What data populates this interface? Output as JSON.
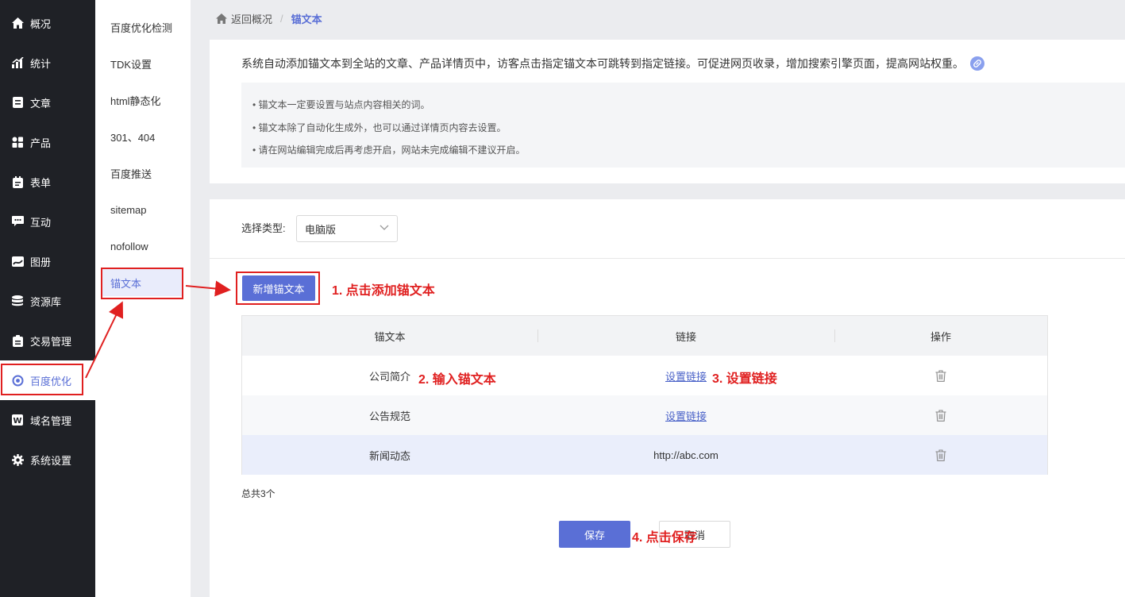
{
  "sidebar": {
    "items": [
      {
        "label": "概况",
        "icon": "home-icon"
      },
      {
        "label": "统计",
        "icon": "stats-icon"
      },
      {
        "label": "文章",
        "icon": "article-icon"
      },
      {
        "label": "产品",
        "icon": "product-icon"
      },
      {
        "label": "表单",
        "icon": "form-icon"
      },
      {
        "label": "互动",
        "icon": "chat-icon"
      },
      {
        "label": "图册",
        "icon": "album-icon"
      },
      {
        "label": "资源库",
        "icon": "database-icon"
      },
      {
        "label": "交易管理",
        "icon": "trade-icon"
      },
      {
        "label": "百度优化",
        "icon": "seo-icon"
      },
      {
        "label": "域名管理",
        "icon": "domain-icon"
      },
      {
        "label": "系统设置",
        "icon": "gear-icon"
      }
    ],
    "active": "百度优化"
  },
  "subnav": {
    "items": [
      "百度优化检测",
      "TDK设置",
      "html静态化",
      "301、404",
      "百度推送",
      "sitemap",
      "nofollow",
      "锚文本"
    ],
    "active": "锚文本"
  },
  "breadcrumb": {
    "back": "返回概况",
    "sep": "/",
    "current": "锚文本"
  },
  "info": {
    "description": "系统自动添加锚文本到全站的文章、产品详情页中，访客点击指定锚文本可跳转到指定链接。可促进网页收录，增加搜索引擎页面，提高网站权重。",
    "tips": [
      "• 锚文本一定要设置与站点内容相关的词。",
      "• 锚文本除了自动化生成外，也可以通过详情页内容去设置。",
      "• 请在网站编辑完成后再考虑开启，网站未完成编辑不建议开启。"
    ]
  },
  "filter": {
    "label": "选择类型:",
    "value": "电脑版"
  },
  "add_button": "新增锚文本",
  "table": {
    "headers": [
      "锚文本",
      "链接",
      "操作"
    ],
    "rows": [
      {
        "anchor": "公司简介",
        "link": "设置链接",
        "link_is_action": true
      },
      {
        "anchor": "公告规范",
        "link": "设置链接",
        "link_is_action": true
      },
      {
        "anchor": "新闻动态",
        "link": "http://abc.com",
        "link_is_action": false
      }
    ]
  },
  "total": "总共3个",
  "save_button": "保存",
  "cancel_button": "取消",
  "annotations": {
    "step1": "1. 点击添加锚文本",
    "step2": "2. 输入锚文本",
    "step3": "3. 设置链接",
    "step4": "4. 点击保存"
  },
  "colors": {
    "accent": "#5a6fd6",
    "sidebar_bg": "#1f2126",
    "annotation": "#e02020"
  }
}
